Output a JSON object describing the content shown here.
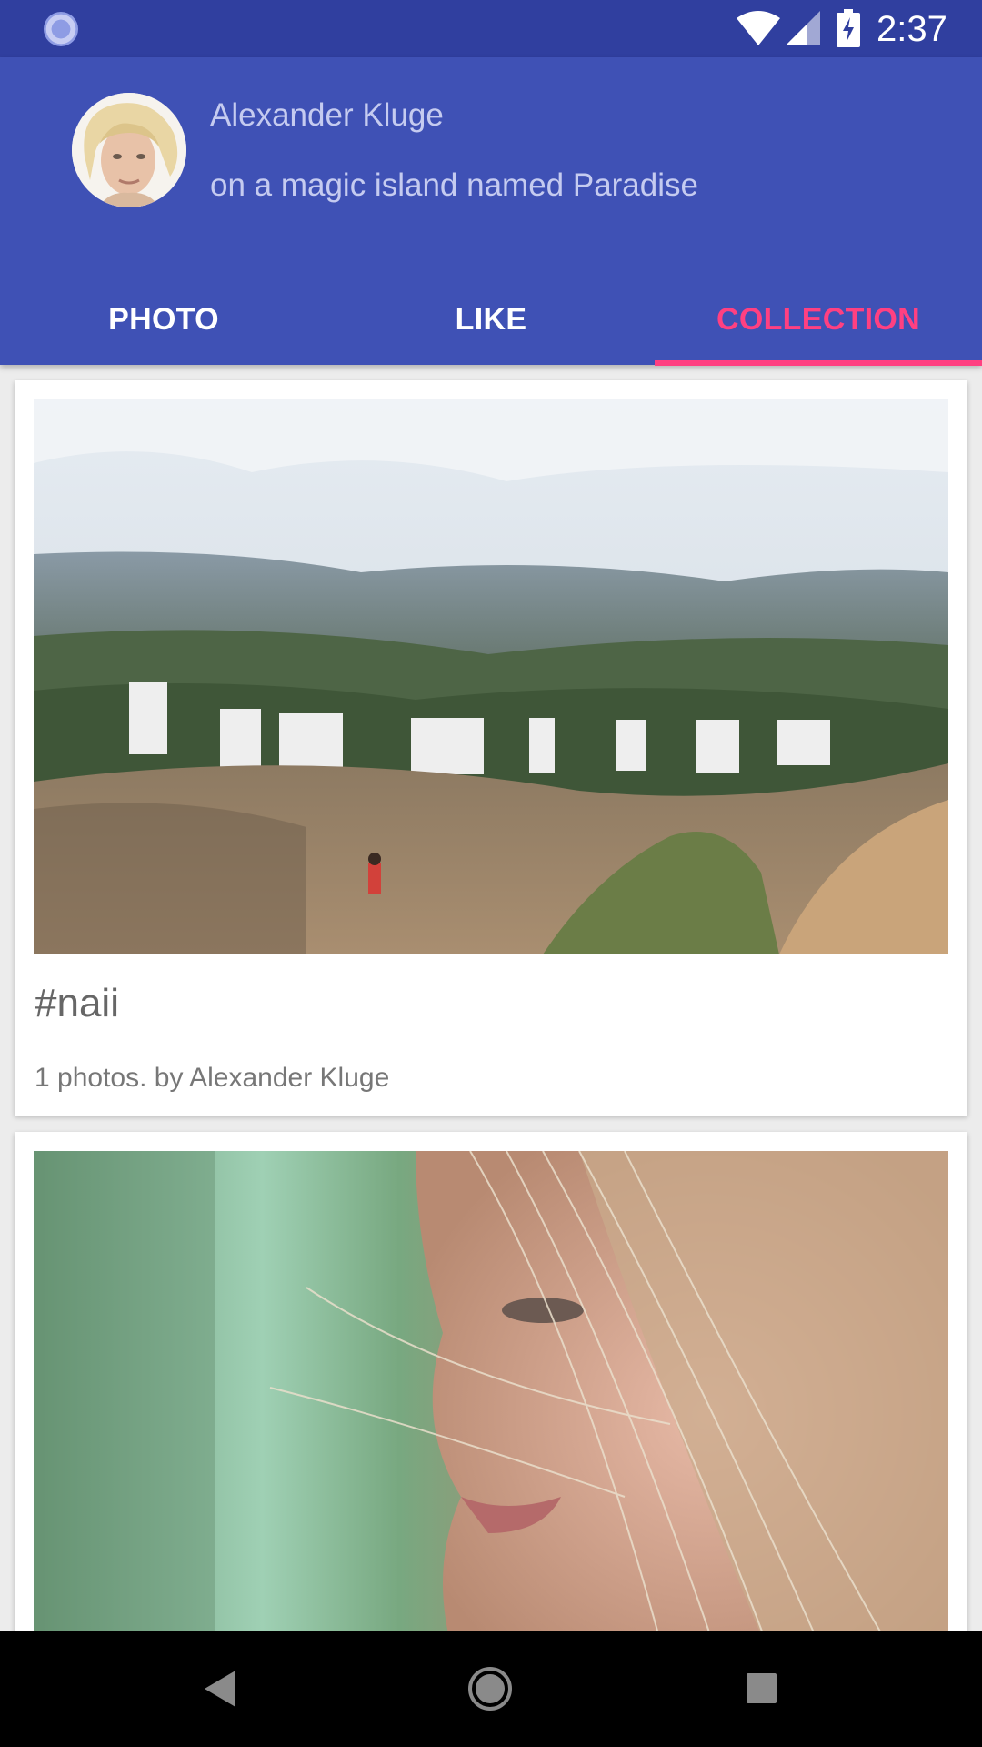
{
  "status_bar": {
    "time": "2:37",
    "icons": [
      "loading-indicator-icon",
      "wifi-icon",
      "cell-signal-icon",
      "battery-charging-icon"
    ]
  },
  "profile": {
    "name": "Alexander Kluge",
    "bio": "on a magic island named Paradise",
    "avatar_icon": "avatar"
  },
  "tabs": [
    {
      "label": "PHOTO",
      "active": false
    },
    {
      "label": "LIKE",
      "active": false
    },
    {
      "label": "COLLECTION",
      "active": true
    }
  ],
  "collections": [
    {
      "title": "#naii",
      "subtitle": "1 photos. by Alexander Kluge",
      "photo": "hollywood-sign-landscape"
    },
    {
      "title": "",
      "subtitle": "",
      "photo": "woman-portrait-hair"
    }
  ],
  "colors": {
    "primary": "#3f51b5",
    "primary_dark": "#303f9f",
    "accent": "#ff4081",
    "header_text": "#c5cbf0"
  },
  "nav_bar": {
    "icons": [
      "back-icon",
      "home-icon",
      "recents-icon"
    ]
  }
}
